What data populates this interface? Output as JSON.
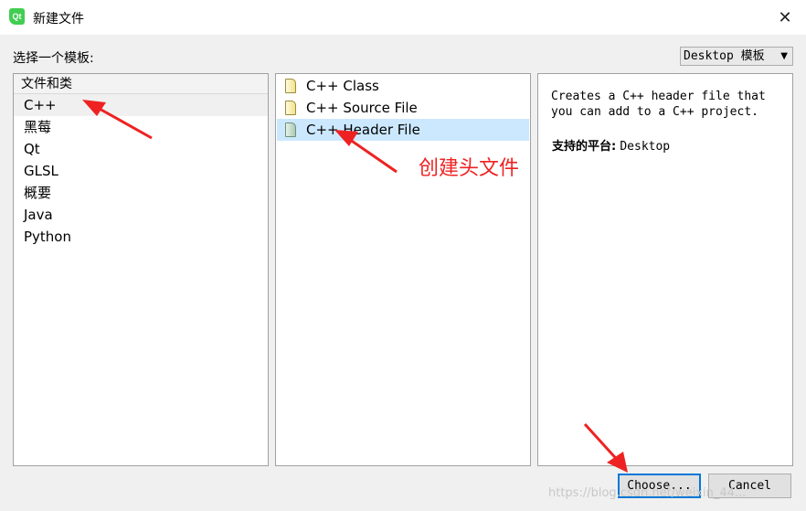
{
  "window": {
    "title": "新建文件",
    "app_icon_text": "Qt",
    "close_glyph": "✕"
  },
  "template_label": "选择一个模板:",
  "platform_dropdown": {
    "value": "Desktop 模板",
    "arrow": "▼"
  },
  "categories": {
    "header": "文件和类",
    "items": [
      "C++",
      "黑莓",
      "Qt",
      "GLSL",
      "概要",
      "Java",
      "Python"
    ],
    "selected_index": 0
  },
  "templates": {
    "items": [
      "C++ Class",
      "C++ Source File",
      "C++ Header File"
    ],
    "selected_index": 2
  },
  "description": {
    "text": "Creates a C++ header file that\nyou can add to a C++ project.",
    "platform_label": "支持的平台:",
    "platform_value": "Desktop"
  },
  "buttons": {
    "choose": "Choose...",
    "cancel": "Cancel"
  },
  "annotation": {
    "text": "创建头文件",
    "color": "#ee2222"
  },
  "watermark": "https://blog.csdn.net/weixin_44..."
}
